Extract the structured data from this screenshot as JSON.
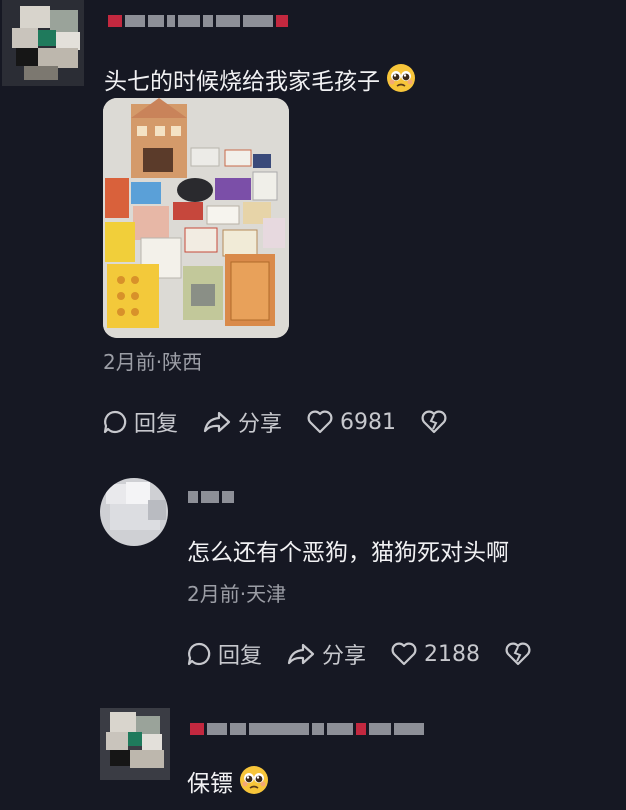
{
  "comments": [
    {
      "text": "头七的时候烧给我家毛孩子",
      "emoji_icon": "pleading-face-emoji",
      "meta": "2月前·陕西",
      "reply_label": "回复",
      "share_label": "分享",
      "likes": "6981"
    },
    {
      "text": "怎么还有个恶狗，猫狗死对头啊",
      "meta": "2月前·天津",
      "reply_label": "回复",
      "share_label": "分享",
      "likes": "2188"
    },
    {
      "text": "保镖",
      "emoji_icon": "pleading-face-emoji"
    }
  ],
  "colors": {
    "background": "#161823",
    "text": "#f1f1f3",
    "meta": "#9c9ea6",
    "actions": "#c7c8cd"
  }
}
